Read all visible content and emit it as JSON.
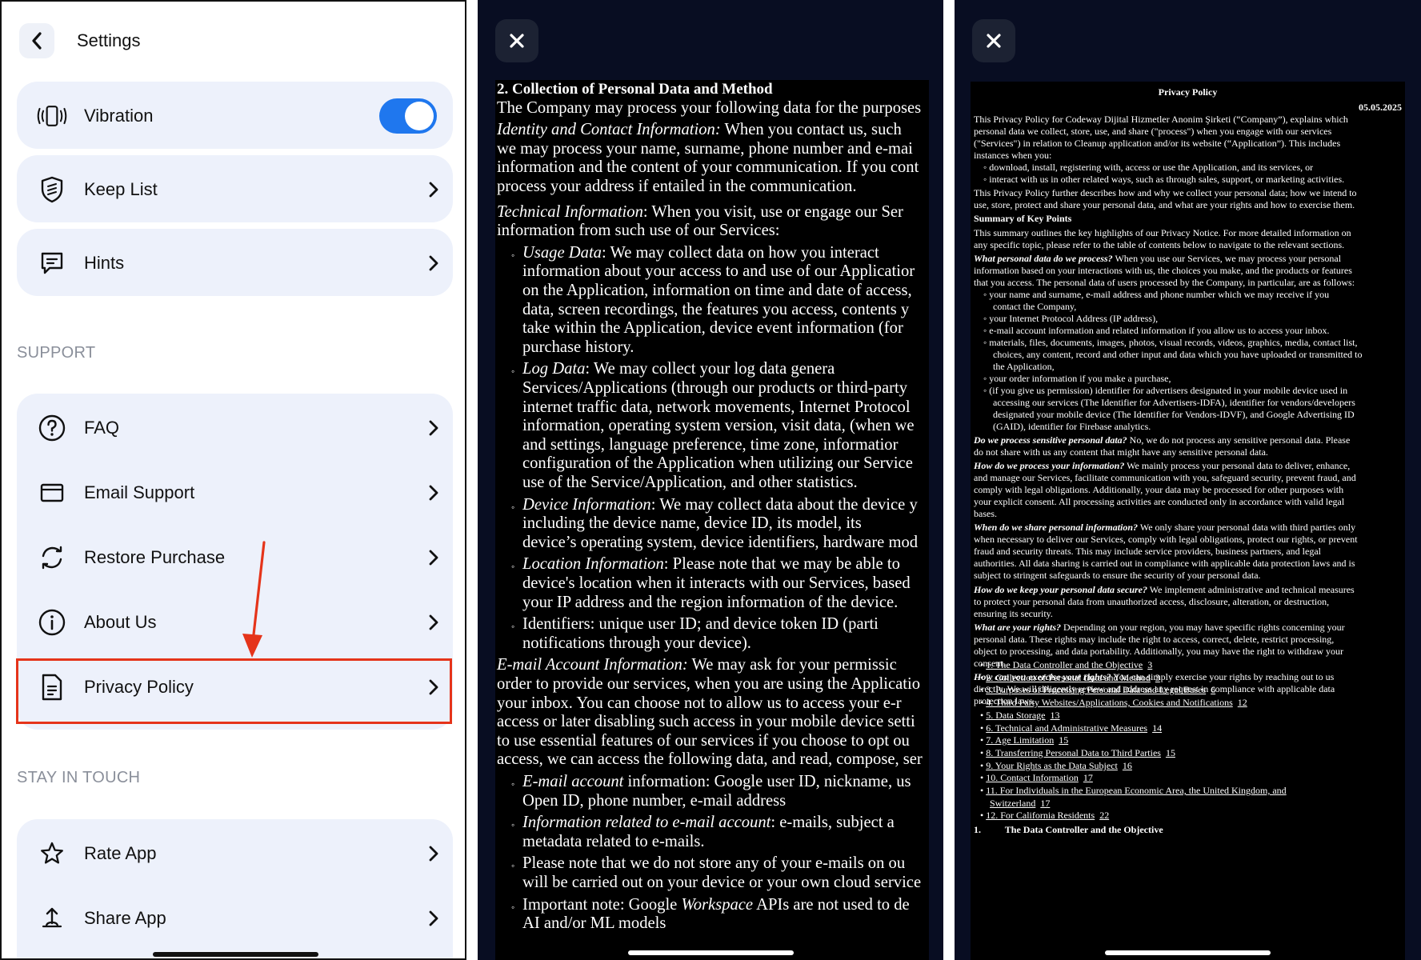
{
  "settings": {
    "title": "Settings",
    "rows_top": [
      {
        "label": "Vibration",
        "icon": "vibration-icon",
        "toggle_on": true
      },
      {
        "label": "Keep List",
        "icon": "shield-icon"
      },
      {
        "label": "Hints",
        "icon": "message-icon"
      }
    ],
    "support_header": "SUPPORT",
    "support_rows": [
      {
        "label": "FAQ",
        "icon": "question-icon"
      },
      {
        "label": "Email Support",
        "icon": "envelope-icon"
      },
      {
        "label": "Restore Purchase",
        "icon": "refresh-icon"
      },
      {
        "label": "About Us",
        "icon": "info-icon"
      },
      {
        "label": "Privacy Policy",
        "icon": "document-icon"
      }
    ],
    "touch_header": "STAY IN TOUCH",
    "touch_rows": [
      {
        "label": "Rate App",
        "icon": "star-icon"
      },
      {
        "label": "Share App",
        "icon": "share-icon"
      }
    ],
    "accent_color": "#1f77ee",
    "highlight_color": "#e5341a"
  },
  "doc_full": {
    "lines": [
      {
        "text": "2.      Collection of Personal Data and Method",
        "style": "bold"
      },
      {
        "text": "The Company may process your following data for the purposes"
      },
      {
        "text": "Identity and Contact Information: When you contact us, such",
        "em": "Identity and Contact Information:"
      },
      {
        "text": "we may process your name, surname, phone number and e-mai"
      },
      {
        "text": "information and the content of your communication. If you cont"
      },
      {
        "text": "process your address if entailed in the communication."
      },
      {
        "text": "Technical Information: When you visit, use or engage our Ser",
        "em": "Technical Information"
      },
      {
        "text": "information from such use of our Services:"
      },
      {
        "text": "Usage Data: We may collect data on how you interact",
        "em": "Usage Data",
        "bullet": true
      },
      {
        "text": "information about your access to and use of our Applicatior",
        "indent": true
      },
      {
        "text": "on the Application, information on time and date of access,",
        "indent": true
      },
      {
        "text": "data, screen recordings, the features you access, contents y",
        "indent": true
      },
      {
        "text": "take within the Application, device event information (for",
        "indent": true
      },
      {
        "text": "purchase history.",
        "indent": true
      },
      {
        "text": "Log Data: We may collect your log data genera",
        "em": "Log Data",
        "bullet": true
      },
      {
        "text": "Services/Applications (through our products or third-party",
        "indent": true
      },
      {
        "text": "internet traffic data, network movements, Internet Protocol",
        "indent": true
      },
      {
        "text": "information, operating system version, visit data, (when we",
        "indent": true
      },
      {
        "text": "and settings, language preference, time zone, informatior",
        "indent": true
      },
      {
        "text": "configuration of the Application when utilizing our Service",
        "indent": true
      },
      {
        "text": "use of the Service/Application, and other statistics.",
        "indent": true
      },
      {
        "text": "Device Information: We may collect data about the device y",
        "em": "Device Information",
        "bullet": true
      },
      {
        "text": "including the device name, device ID, its model, its",
        "indent": true
      },
      {
        "text": "device’s operating system, device identifiers, hardware mod",
        "indent": true
      },
      {
        "text": "Location Information: Please note that we may be able to",
        "em": "Location Information",
        "bullet": true
      },
      {
        "text": "device's location when it interacts with our Services, based",
        "indent": true
      },
      {
        "text": "your IP address and the region information of the device.",
        "indent": true
      },
      {
        "text": "Identifiers: unique user ID; and device token ID (parti",
        "bullet": true
      },
      {
        "text": "notifications through your device).",
        "indent": true
      },
      {
        "text": "E-mail Account Information: We may ask for your permissic",
        "em": "E-mail Account Information:"
      },
      {
        "text": "order to provide our services, when you are using the Applicatio"
      },
      {
        "text": "your inbox. You can choose not to allow us to access your e-r"
      },
      {
        "text": "access or later disabling such access in your mobile device setti"
      },
      {
        "text": "to use essential features of our services if you choose to opt ou"
      },
      {
        "text": "access, we can access the following data, and read, compose, ser"
      },
      {
        "text": "E-mail account information: Google user ID, nickname, us",
        "em": "E-mail account",
        "bullet": true
      },
      {
        "text": "Open ID, phone number, e-mail address",
        "indent": true
      },
      {
        "text": "Information related to e-mail account: e-mails, subject a",
        "em": "Information related to e-mail account",
        "bullet": true
      },
      {
        "text": "metadata related to e-mails.",
        "indent": true
      },
      {
        "text": "Please note that we do not store any of your e-mails on ou",
        "bullet": true
      },
      {
        "text": "will be carried out on your device or your own cloud service",
        "indent": true
      },
      {
        "text": "Important note: Google Workspace APIs are not used to de",
        "em": "Workspace",
        "bullet": true
      },
      {
        "text": "AI and/or ML models",
        "indent": true
      }
    ]
  },
  "doc_summary": {
    "title": "Privacy Policy",
    "date": "05.05.2025",
    "lines": [
      {
        "text": "This Privacy Policy for Codeway Dijital Hizmetler Anonim Şirketi (“Company”), explains which"
      },
      {
        "text": "personal data we collect, store, use, and share (\"process\") when you engage with our services"
      },
      {
        "text": "(\"Services\") in relation to Cleanup application and/or its website (“Application”). This includes"
      },
      {
        "text": "instances when you:"
      },
      {
        "text": "◦  download, install, registering with, access or use the Application, and its services, or",
        "ind": 1
      },
      {
        "text": "◦  interact with us in other related ways, such as through sales, support, or marketing activities.",
        "ind": 1
      },
      {
        "text": "This Privacy Policy further describes how and why we collect your personal data; how we intend to"
      },
      {
        "text": "use, store, protect and share your personal data, and what are your rights and how to exercise them."
      },
      {
        "text": "Summary of Key Points",
        "bold": true
      },
      {
        "text": "This summary outlines the key highlights of our Privacy Notice. For more detailed information on"
      },
      {
        "text": "any specific topic, please refer to the table of contents below to navigate to the relevant sections."
      },
      {
        "text": "What personal data do we process? When you use our Services, we may process your personal",
        "em": "What personal data do we process?"
      },
      {
        "text": "information based on your interactions with us, the choices you make, and the products or features"
      },
      {
        "text": "that you access. The personal data of users processed by the Company, in particular, are as follows:"
      },
      {
        "text": "◦  your name and surname, e-mail address and phone number which we may receive if you",
        "ind": 1
      },
      {
        "text": "contact the Company,",
        "ind": 2
      },
      {
        "text": "◦  your Internet Protocol Address (IP address),",
        "ind": 1
      },
      {
        "text": "◦  e-mail account information and related information if you allow us to access your inbox.",
        "ind": 1
      },
      {
        "text": "◦  materials, files, documents, images, photos, visual records, videos, graphics, media, contact list,",
        "ind": 1
      },
      {
        "text": "choices, any content, record and other input and data which you have uploaded or transmitted to",
        "ind": 2
      },
      {
        "text": "the Application,",
        "ind": 2
      },
      {
        "text": "◦  your order information if you make a purchase,",
        "ind": 1
      },
      {
        "text": "◦  (if you give us permission) identifier for advertisers designated in your mobile device used in",
        "ind": 1
      },
      {
        "text": "accessing our services (The Identifier for Advertisers-IDFA), identifier for vendors/developers",
        "ind": 2
      },
      {
        "text": "designated your mobile device (The Identifier for Vendors-IDVF), and Google Advertising ID",
        "ind": 2
      },
      {
        "text": "(GAID), identifier for Firebase analytics.",
        "ind": 2
      },
      {
        "text": "Do we process sensitive personal data? No, we do not process any sensitive personal data. Please",
        "em": "Do we process sensitive personal data?"
      },
      {
        "text": "do not share with us any content that might have any sensitive personal data."
      },
      {
        "text": "How do we process your information? We mainly process your personal data to deliver, enhance,",
        "em": "How do we process your information?"
      },
      {
        "text": "and manage our Services, facilitate communication with you, safeguard security, prevent fraud, and"
      },
      {
        "text": "comply with legal obligations. Additionally, your data may be processed for other purposes with"
      },
      {
        "text": "your explicit consent. All processing activities are conducted only in accordance with valid legal"
      },
      {
        "text": "bases."
      },
      {
        "text": "When do we share personal information? We only share your personal data with third parties only",
        "em": "When do we share personal information?"
      },
      {
        "text": "when necessary to deliver our Services, comply with legal obligations, protect our rights, or prevent"
      },
      {
        "text": "fraud and security threats. This may include service providers, business partners, and legal"
      },
      {
        "text": "authorities. All data sharing is carried out in compliance with applicable data protection laws and is"
      },
      {
        "text": "subject to stringent safeguards to ensure the security of your personal data."
      },
      {
        "text": "How do we keep your personal data secure? We implement administrative and technical measures",
        "em": "How do we keep your personal data secure?"
      },
      {
        "text": "to protect your personal data from unauthorized access, disclosure, alteration, or destruction,"
      },
      {
        "text": "ensuring its security."
      },
      {
        "text": "What are your rights? Depending on your region, you may have specific rights concerning your",
        "em": "What are your rights?"
      },
      {
        "text": "personal data. These rights may include the right to access, correct, delete, restrict processing,"
      },
      {
        "text": "object to processing, and data portability. Additionally, you may have the right to withdraw your"
      },
      {
        "text": "consent."
      },
      {
        "text": "How can you exercise your rights? You can simply exercise your rights by reaching out to us",
        "em": "How can you exercise your rights?"
      },
      {
        "text": "directly. We will diligently review and address any request in compliance with applicable data"
      },
      {
        "text": "protection laws."
      }
    ],
    "toc": [
      {
        "text": "1. The Data Controller and the Objective",
        "page": "3"
      },
      {
        "text": "2. Collection of Personal Data and Method",
        "page": "3"
      },
      {
        "text": "3. Purposes of Processing Personal Data and Legal Bases",
        "page": "6"
      },
      {
        "text": "4. Third Party Websites/Applications, Cookies and Notifications",
        "page": "12"
      },
      {
        "text": "5. Data Storage",
        "page": "13"
      },
      {
        "text": "6. Technical and Administrative Measures",
        "page": "14"
      },
      {
        "text": "7. Age Limitation",
        "page": "15"
      },
      {
        "text": "8. Transferring Personal Data to Third Parties",
        "page": "15"
      },
      {
        "text": "9. Your Rights as the Data Subject",
        "page": "16"
      },
      {
        "text": "10. Contact Information",
        "page": "17"
      },
      {
        "text": "11. For Individuals in the European Economic Area, the United Kingdom, and",
        "page": ""
      },
      {
        "text": "Switzerland",
        "page": "17"
      },
      {
        "text": "12. For California Residents",
        "page": "22"
      }
    ],
    "footer_heading": "1.          The Data Controller and the Objective"
  }
}
